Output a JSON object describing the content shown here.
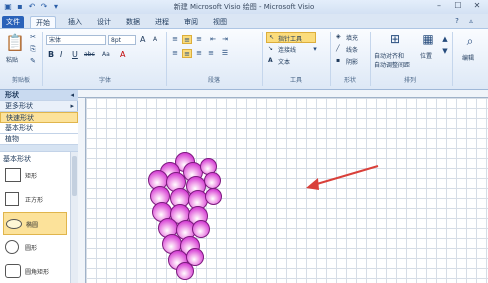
{
  "window": {
    "title": "新建 Microsoft Visio 绘图 - Microsoft Visio"
  },
  "tabs": [
    "文件",
    "开始",
    "插入",
    "设计",
    "数据",
    "进程",
    "审阅",
    "视图"
  ],
  "ribbon": {
    "clipboard": {
      "paste": "粘贴",
      "label": "剪贴板"
    },
    "font": {
      "name": "宋体",
      "size": "8pt",
      "grow": "A",
      "shrink": "A",
      "bold": "B",
      "italic": "I",
      "underline": "U",
      "strike": "abc",
      "aa": "Aa",
      "font_color": "A",
      "label": "字体"
    },
    "paragraph": {
      "label": "段落"
    },
    "tools": {
      "pointer": "指针工具",
      "connector": "连接线",
      "text": "文本",
      "label": "工具"
    },
    "shape": {
      "fill": "填充",
      "line": "线条",
      "shadow": "阴影",
      "label": "形状"
    },
    "arrange": {
      "align": "自动对齐和",
      "space": "自动调整间距",
      "position": "位置",
      "label": "排列"
    },
    "editing": {
      "label": "编辑"
    }
  },
  "shapes_pane": {
    "header": "形状",
    "more": "更多形状",
    "quick": "快速形状",
    "basic": "基本形状",
    "plant": "植物",
    "section": "基本形状",
    "items": [
      "矩形",
      "正方形",
      "椭圆",
      "圆形",
      "圆角矩形"
    ]
  },
  "colors": {
    "accent": "#2a62b9",
    "selected": "#fbdc7c",
    "grape": "#d84ad6",
    "arrow": "#d9403a"
  }
}
